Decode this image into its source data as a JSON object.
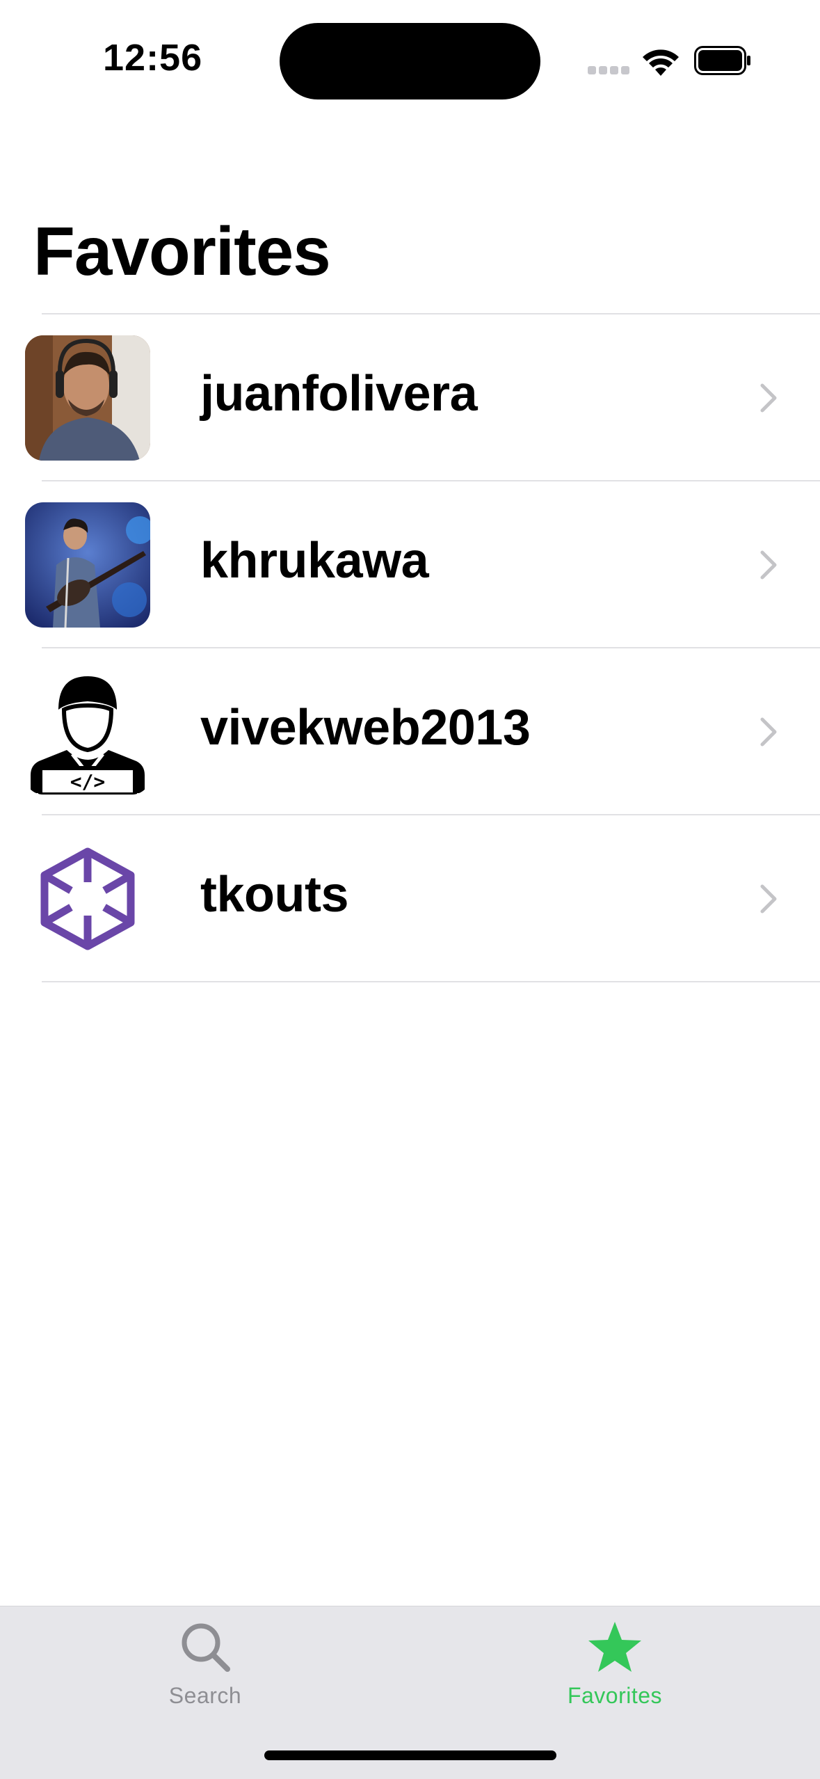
{
  "status_bar": {
    "time": "12:56"
  },
  "header": {
    "title": "Favorites"
  },
  "favorites": [
    {
      "username": "juanfolivera",
      "avatar": "photo-man-headphones"
    },
    {
      "username": "khrukawa",
      "avatar": "photo-guitarist-stage"
    },
    {
      "username": "vivekweb2013",
      "avatar": "developer-icon"
    },
    {
      "username": "tkouts",
      "avatar": "cube-logo-purple"
    }
  ],
  "tab_bar": {
    "tabs": [
      {
        "label": "Search",
        "icon": "search-icon",
        "selected": false
      },
      {
        "label": "Favorites",
        "icon": "star-icon",
        "selected": true
      }
    ]
  },
  "colors": {
    "accent": "#34c759",
    "inactive": "#8e8e93",
    "tab_bar_bg": "#e6e6ea",
    "divider": "#e1e1e4",
    "cube_purple": "#6a46a8"
  }
}
